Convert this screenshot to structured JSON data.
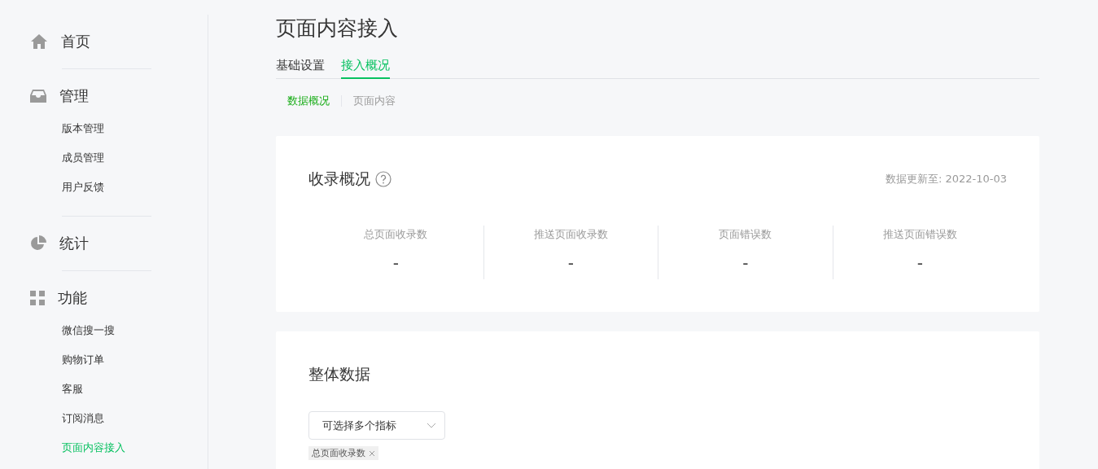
{
  "sidebar": {
    "groups": [
      {
        "label": "首页"
      },
      {
        "label": "管理",
        "items": [
          {
            "label": "版本管理",
            "selected": false
          },
          {
            "label": "成员管理",
            "selected": false
          },
          {
            "label": "用户反馈",
            "selected": false
          }
        ]
      },
      {
        "label": "统计"
      },
      {
        "label": "功能",
        "items": [
          {
            "label": "微信搜一搜",
            "selected": false
          },
          {
            "label": "购物订单",
            "selected": false
          },
          {
            "label": "客服",
            "selected": false
          },
          {
            "label": "订阅消息",
            "selected": false
          },
          {
            "label": "页面内容接入",
            "selected": true
          }
        ]
      }
    ]
  },
  "page_title": "页面内容接入",
  "tabs": [
    {
      "label": "基础设置",
      "selected": false
    },
    {
      "label": "接入概况",
      "selected": true
    }
  ],
  "subtabs": [
    {
      "label": "数据概况",
      "selected": true
    },
    {
      "label": "页面内容",
      "selected": false
    }
  ],
  "overview": {
    "title": "收录概况",
    "updated": "数据更新至: 2022-10-03",
    "stats": [
      {
        "label": "总页面收录数",
        "value": "-"
      },
      {
        "label": "推送页面收录数",
        "value": "-"
      },
      {
        "label": "页面错误数",
        "value": "-"
      },
      {
        "label": "推送页面错误数",
        "value": "-"
      }
    ]
  },
  "overall": {
    "title": "整体数据",
    "select": {
      "placeholder": "可选择多个指标"
    },
    "tags": [
      "总页面收录数"
    ]
  }
}
